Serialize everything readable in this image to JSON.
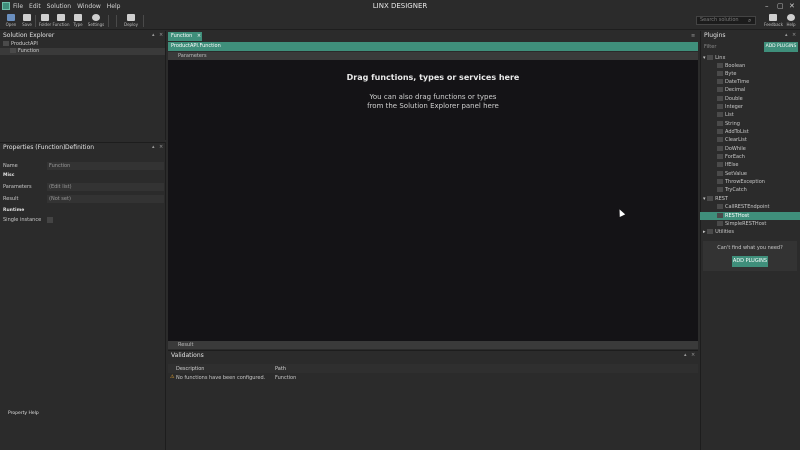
{
  "app": {
    "title": "LINX DESIGNER"
  },
  "menu": {
    "items": [
      "File",
      "Edit",
      "Solution",
      "Window",
      "Help"
    ]
  },
  "window_controls": {
    "minimize": "–",
    "maximize": "▢",
    "close": "✕"
  },
  "toolbar": {
    "buttons": [
      {
        "label": "Open",
        "icon": "open-icon",
        "color": "#6a8fbf"
      },
      {
        "label": "Save",
        "icon": "save-icon",
        "color": "#cfcfcf"
      },
      {
        "label": "Folder",
        "icon": "folder-icon",
        "color": "#cfcfcf"
      },
      {
        "label": "Function",
        "icon": "function-icon",
        "color": "#cfcfcf"
      },
      {
        "label": "Type",
        "icon": "type-icon",
        "color": "#cfcfcf"
      },
      {
        "label": "Settings",
        "icon": "gear-icon",
        "color": "#cfcfcf"
      },
      {
        "label": "Deploy",
        "icon": "deploy-icon",
        "color": "#cfcfcf"
      }
    ],
    "right_buttons": [
      {
        "label": "Feedback",
        "icon": "feedback-icon"
      },
      {
        "label": "Help",
        "icon": "help-icon"
      }
    ],
    "search_placeholder": "Search solution"
  },
  "solution_explorer": {
    "title": "Solution Explorer",
    "items": [
      {
        "label": "ProductAPI",
        "icon": "solution-icon"
      },
      {
        "label": "Function",
        "icon": "function-icon"
      }
    ]
  },
  "properties": {
    "tabs": [
      "Properties (Function)",
      "Definition"
    ],
    "rows": [
      {
        "label": "Name",
        "value": "Function"
      },
      {
        "category": "Misc"
      },
      {
        "label": "Parameters",
        "value": "(Edit list)"
      },
      {
        "label": "Result",
        "value": "(Not set)"
      },
      {
        "category": "Runtime"
      },
      {
        "label": "Single instance",
        "value": ""
      }
    ],
    "footer": "Property Help"
  },
  "document": {
    "tab_label": "Function",
    "tab_close": "×",
    "breadcrumb": "ProductAPI.Function",
    "parameters_label": "Parameters",
    "result_label": "Result",
    "drag_title": "Drag functions, types or services here",
    "drag_line1": "You can also drag functions or types",
    "drag_line2": "from the Solution Explorer panel here"
  },
  "validations": {
    "title": "Validations",
    "columns": [
      "Description",
      "Path"
    ],
    "rows": [
      {
        "description": "No functions have been configured.",
        "path": "Function",
        "severity": "warning"
      }
    ]
  },
  "plugins": {
    "title": "Plugins",
    "filter_placeholder": "Filter",
    "add_button": "ADD PLUGINS",
    "groups": [
      {
        "name": "Linx",
        "items": [
          "Boolean",
          "Byte",
          "DateTime",
          "Decimal",
          "Double",
          "Integer",
          "List",
          "String",
          "AddToList",
          "ClearList",
          "DoWhile",
          "ForEach",
          "IfElse",
          "SetValue",
          "ThrowException",
          "TryCatch"
        ]
      },
      {
        "name": "REST",
        "items": [
          "CallRESTEndpoint",
          "RESTHost",
          "SimpleRESTHost"
        ]
      },
      {
        "name": "Utilities",
        "items": []
      }
    ],
    "selected_item": "RESTHost",
    "help_text": "Can't find what you need?",
    "help_button": "ADD PLUGINS"
  },
  "colors": {
    "accent": "#3f8f7b",
    "canvas": "#141316",
    "panel": "#2b2b2b"
  }
}
